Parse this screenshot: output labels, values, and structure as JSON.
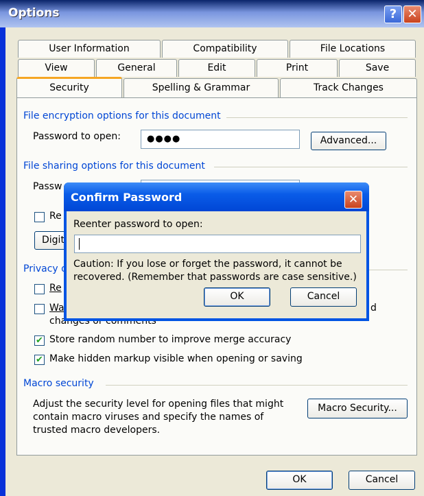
{
  "options": {
    "title": "Options",
    "help_glyph": "?",
    "close_glyph": "✕",
    "tabs_row1": [
      "User Information",
      "Compatibility",
      "File Locations"
    ],
    "tabs_row2": [
      "View",
      "General",
      "Edit",
      "Print",
      "Save"
    ],
    "tabs_row3": [
      "Security",
      "Spelling & Grammar",
      "Track Changes"
    ],
    "active_tab": "Security",
    "encryption": {
      "group_label": "File encryption options for this document",
      "password_label": "Password to open:",
      "password_value": "●●●●",
      "advanced_button": "Advanced..."
    },
    "sharing": {
      "group_label": "File sharing options for this document",
      "password_label_partial": "Passw",
      "readonly_partial": "Re",
      "digital_partial": "Digita"
    },
    "privacy": {
      "group_label_partial": "Privacy o",
      "remove_partial": "Re",
      "warn_partial": "Wa",
      "warn_trailing": "d",
      "warn_line2": "changes or comments",
      "store_random": "Store random number to improve merge accuracy",
      "store_random_checked": true,
      "hidden_markup": "Make hidden markup visible when opening or saving",
      "hidden_markup_checked": true
    },
    "macro": {
      "group_label": "Macro security",
      "description": "Adjust the security level for opening files that might contain macro viruses and specify the names of trusted macro developers.",
      "button": "Macro Security..."
    },
    "ok_button": "OK",
    "cancel_button": "Cancel"
  },
  "confirm": {
    "title": "Confirm Password",
    "close_glyph": "✕",
    "prompt": "Reenter password to open:",
    "input_value": "",
    "caution": "Caution:  If you lose or forget the password, it cannot be recovered. (Remember that passwords are case sensitive.)",
    "ok_button": "OK",
    "cancel_button": "Cancel"
  }
}
